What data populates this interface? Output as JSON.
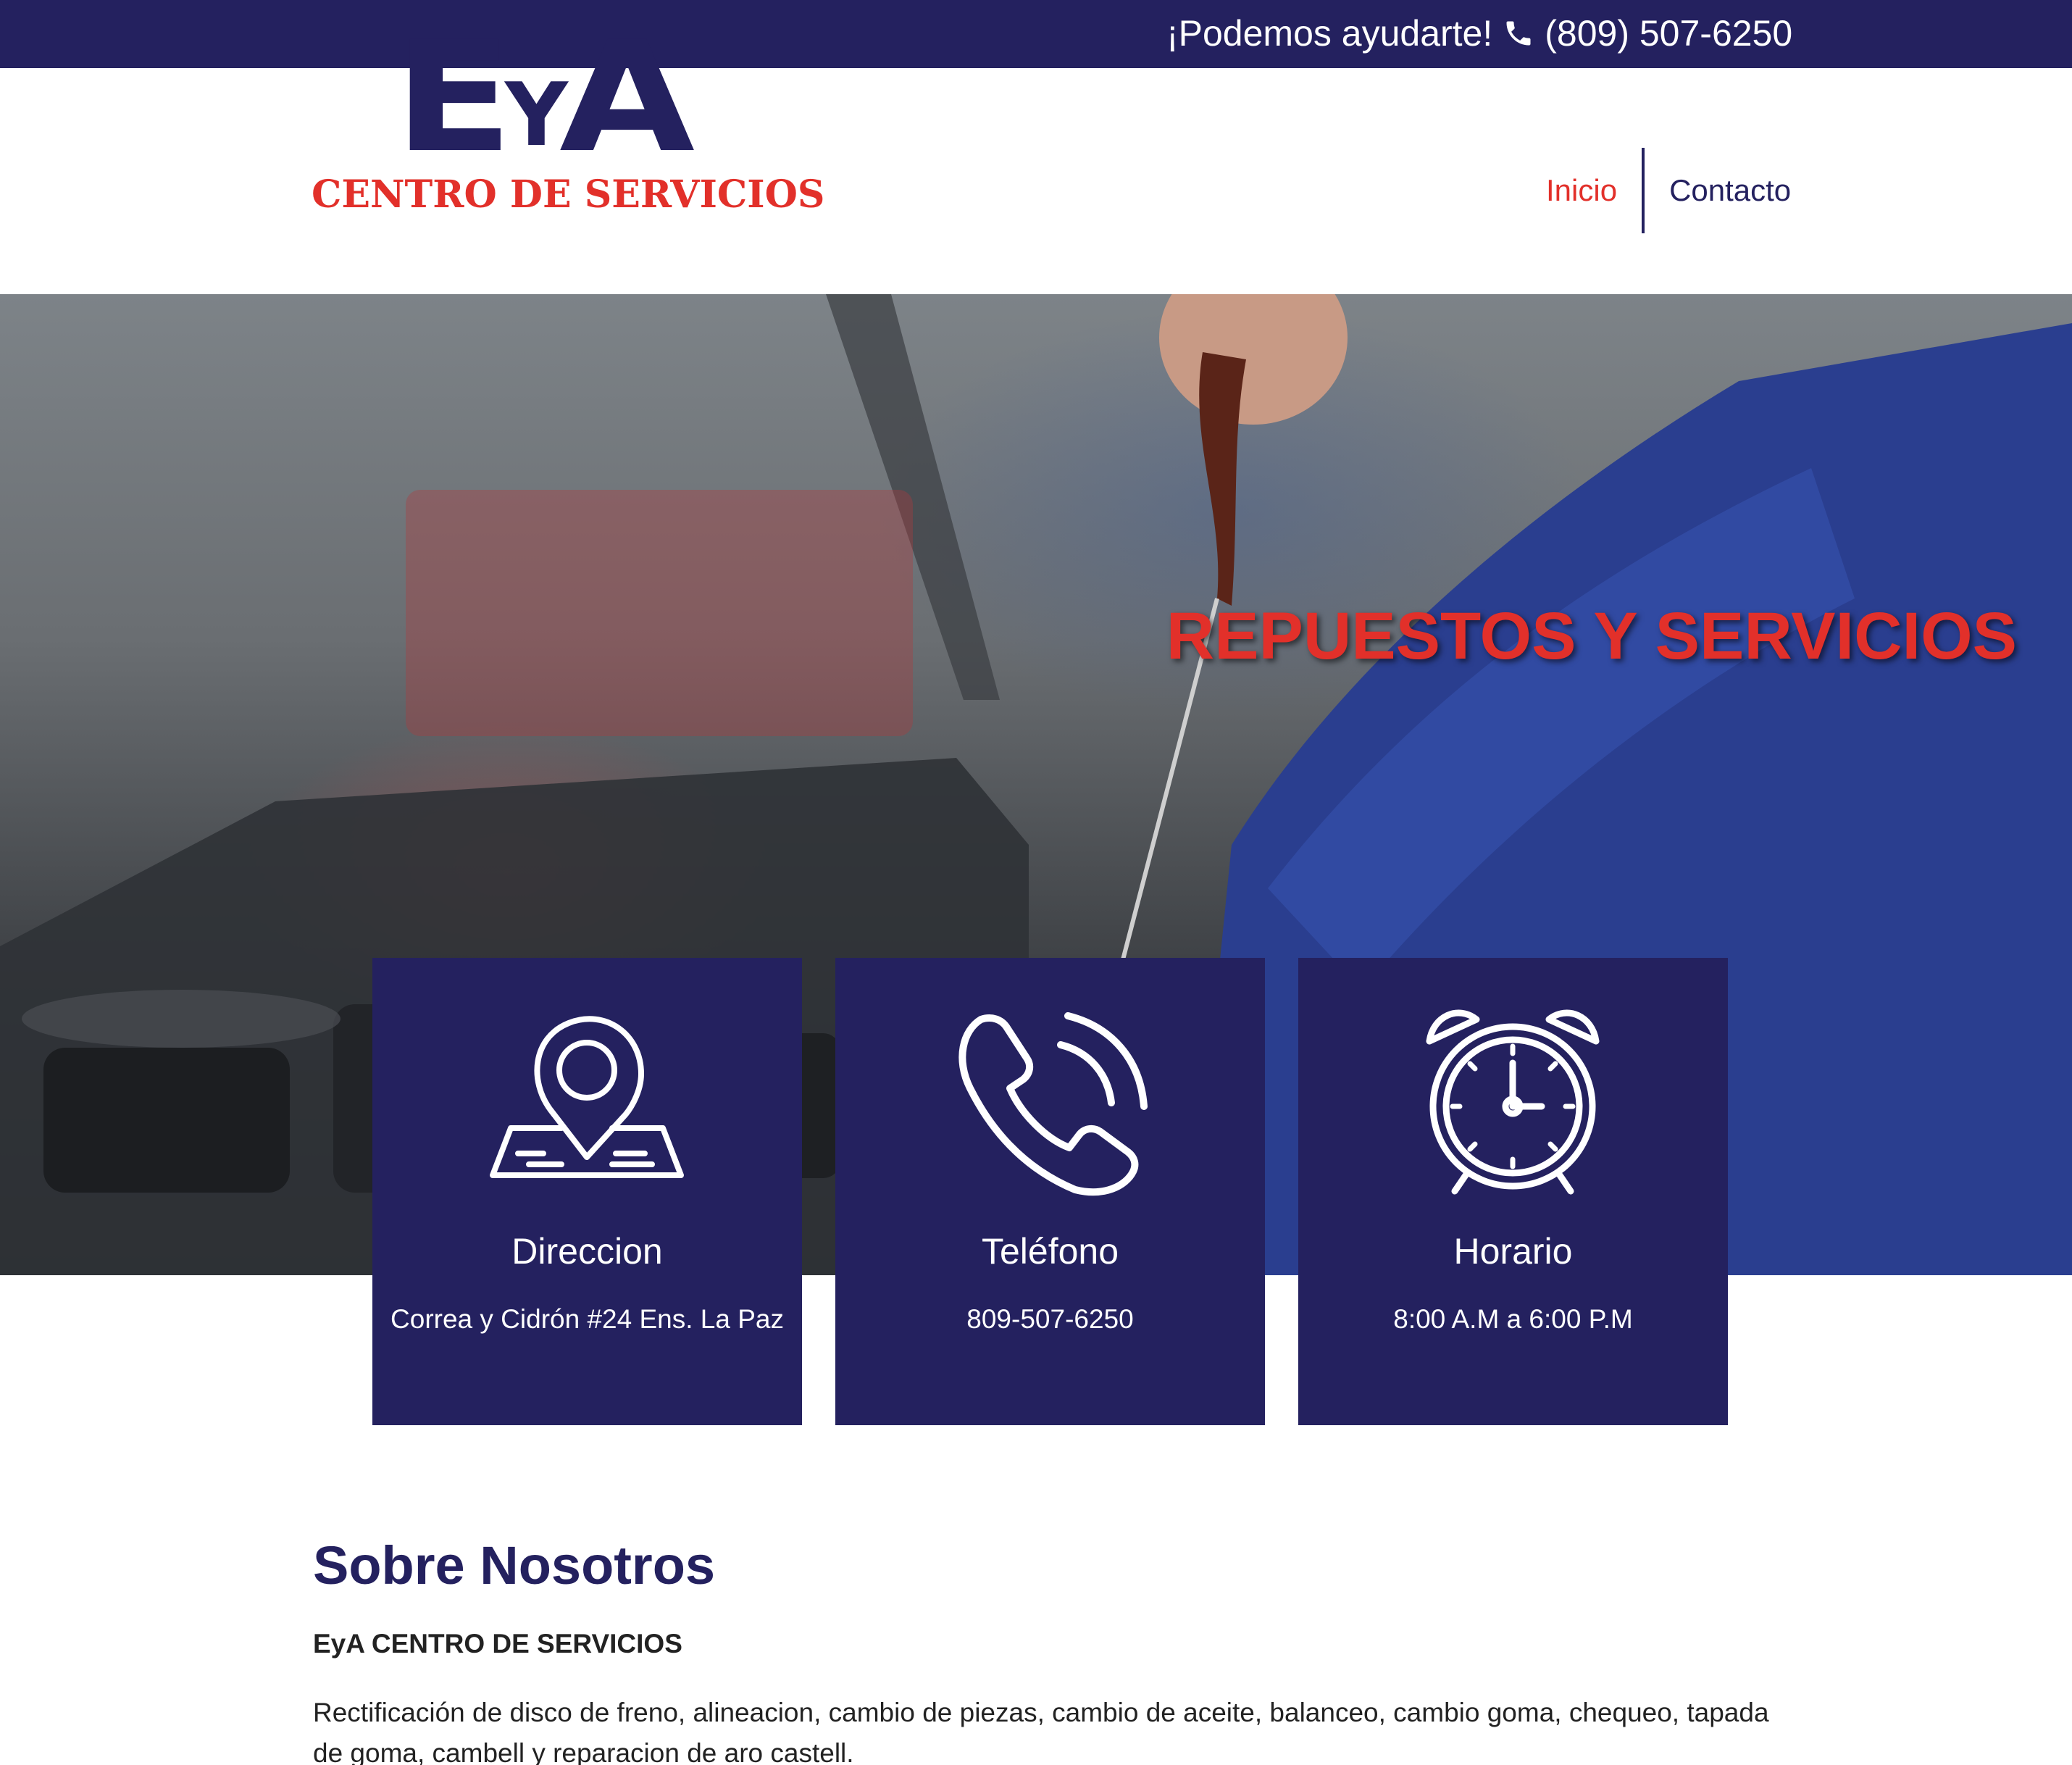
{
  "topbar": {
    "tagline": "¡Podemos ayudarte!",
    "phone": "(809) 507-6250",
    "phone_icon": "phone-icon"
  },
  "logo": {
    "mark_e": "E",
    "mark_y": "Y",
    "mark_a": "A",
    "subtitle": "CENTRO DE SERVICIOS"
  },
  "nav": {
    "items": [
      {
        "label": "Inicio",
        "active": true
      },
      {
        "label": "Contacto",
        "active": false
      }
    ]
  },
  "hero": {
    "headline": "REPUESTOS Y SERVICIOS"
  },
  "cards": [
    {
      "icon": "map-pin-icon",
      "title": "Direccion",
      "value": "Correa y Cidrón #24 Ens. La Paz"
    },
    {
      "icon": "phone-ringing-icon",
      "title": "Teléfono",
      "value": "809-507-6250"
    },
    {
      "icon": "alarm-clock-icon",
      "title": "Horario",
      "value": "8:00 A.M a 6:00 P.M"
    }
  ],
  "about": {
    "title": "Sobre Nosotros",
    "subtitle": "EyA CENTRO DE SERVICIOS",
    "body": "Rectificación de disco de freno, alineacion, cambio de piezas, cambio de aceite, balanceo, cambio goma, chequeo, tapada de goma, cambell y reparacion de aro castell."
  },
  "colors": {
    "brand_navy": "#24215f",
    "brand_red": "#e2302a",
    "text_dark": "#222222"
  }
}
